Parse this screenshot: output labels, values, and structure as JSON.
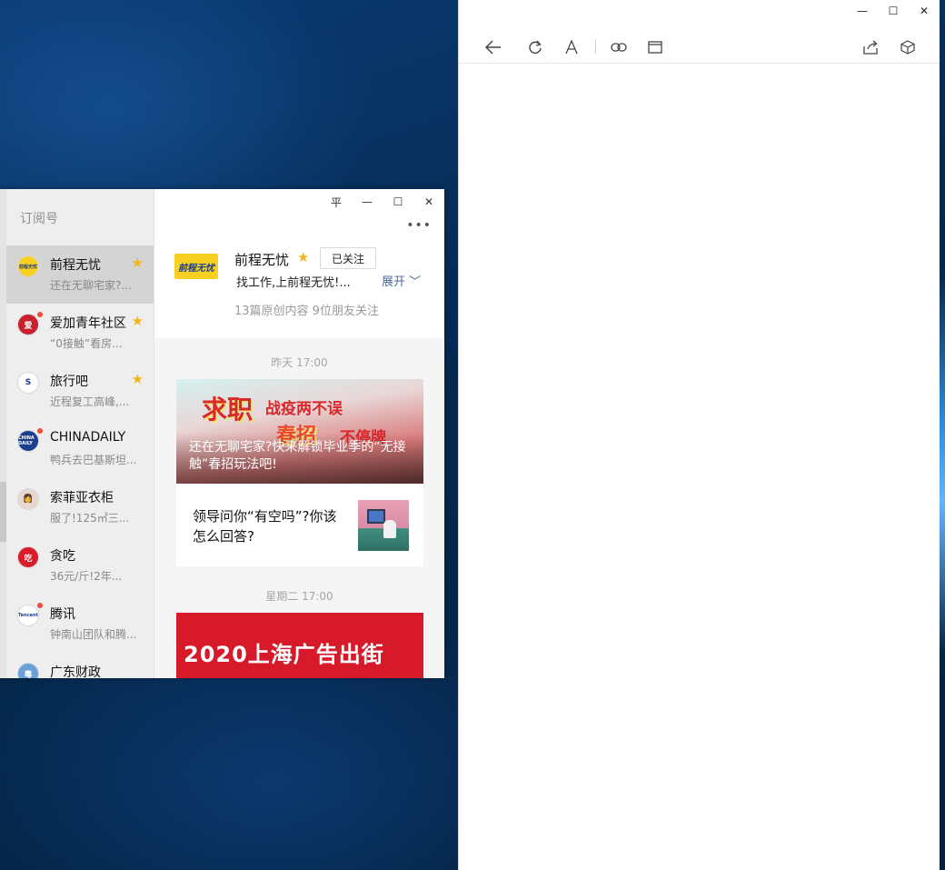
{
  "reader": {
    "window_controls": [
      "—",
      "☐",
      "✕"
    ],
    "toolbar_icons": [
      "back-arrow-icon",
      "refresh-icon",
      "font-size-icon",
      "link-icon",
      "window-icon",
      "share-icon",
      "cube-icon"
    ]
  },
  "wechat": {
    "sidebar": {
      "title": "订阅号",
      "accounts": [
        {
          "name": "前程无忧",
          "preview": "还在无聊宅家?...",
          "starred": true,
          "unread": false,
          "selected": true,
          "avatar_text": "前程无忧",
          "avatar_color": "#f7d021"
        },
        {
          "name": "爱加青年社区",
          "preview": "“0接触”看房...",
          "starred": true,
          "unread": true,
          "selected": false,
          "avatar_text": "爱",
          "avatar_color": "#c8202f"
        },
        {
          "name": "旅行吧",
          "preview": "近程复工高峰,...",
          "starred": true,
          "unread": false,
          "selected": false,
          "avatar_text": "S",
          "avatar_color": "#ffffff"
        },
        {
          "name": "CHINADAILY",
          "preview": "鸭兵去巴基斯坦...",
          "starred": false,
          "unread": true,
          "selected": false,
          "avatar_text": "CHINA DAILY",
          "avatar_color": "#1a3f8f"
        },
        {
          "name": "索菲亚衣柜",
          "preview": "服了!125㎡三...",
          "starred": false,
          "unread": false,
          "selected": false,
          "avatar_text": "👩",
          "avatar_color": "#e8d7cf"
        },
        {
          "name": "贪吃",
          "preview": "36元/斤!2年...",
          "starred": false,
          "unread": false,
          "selected": false,
          "avatar_text": "吃",
          "avatar_color": "#d81c2a"
        },
        {
          "name": "腾讯",
          "preview": "钟南山团队和腾...",
          "starred": false,
          "unread": true,
          "selected": false,
          "avatar_text": "Tencent",
          "avatar_color": "#ffffff"
        },
        {
          "name": "广东财政",
          "preview": "",
          "starred": false,
          "unread": false,
          "selected": false,
          "avatar_text": "粤",
          "avatar_color": "#6aa0d8"
        }
      ]
    },
    "window_controls": [
      "平",
      "—",
      "☐",
      "✕"
    ],
    "more": "•••",
    "profile": {
      "name": "前程无忧",
      "follow_label": "已关注",
      "description": "找工作,上前程无忧!...",
      "expand_label": "展开",
      "stats": "13篇原创内容   9位朋友关注",
      "logo_text": "前程无忧"
    },
    "posts": [
      {
        "time": "昨天 17:00",
        "cover_title_parts": [
          "求职",
          "战疫两不误",
          "春招",
          "不停牌"
        ],
        "cover_caption": "还在无聊宅家?快来解锁毕业季的“无接触”春招玩法吧!",
        "sub_title": "领导问你“有空吗”?你该怎么回答?"
      },
      {
        "time": "星期二 17:00",
        "cover_title": "2020上海广告出街"
      }
    ]
  }
}
